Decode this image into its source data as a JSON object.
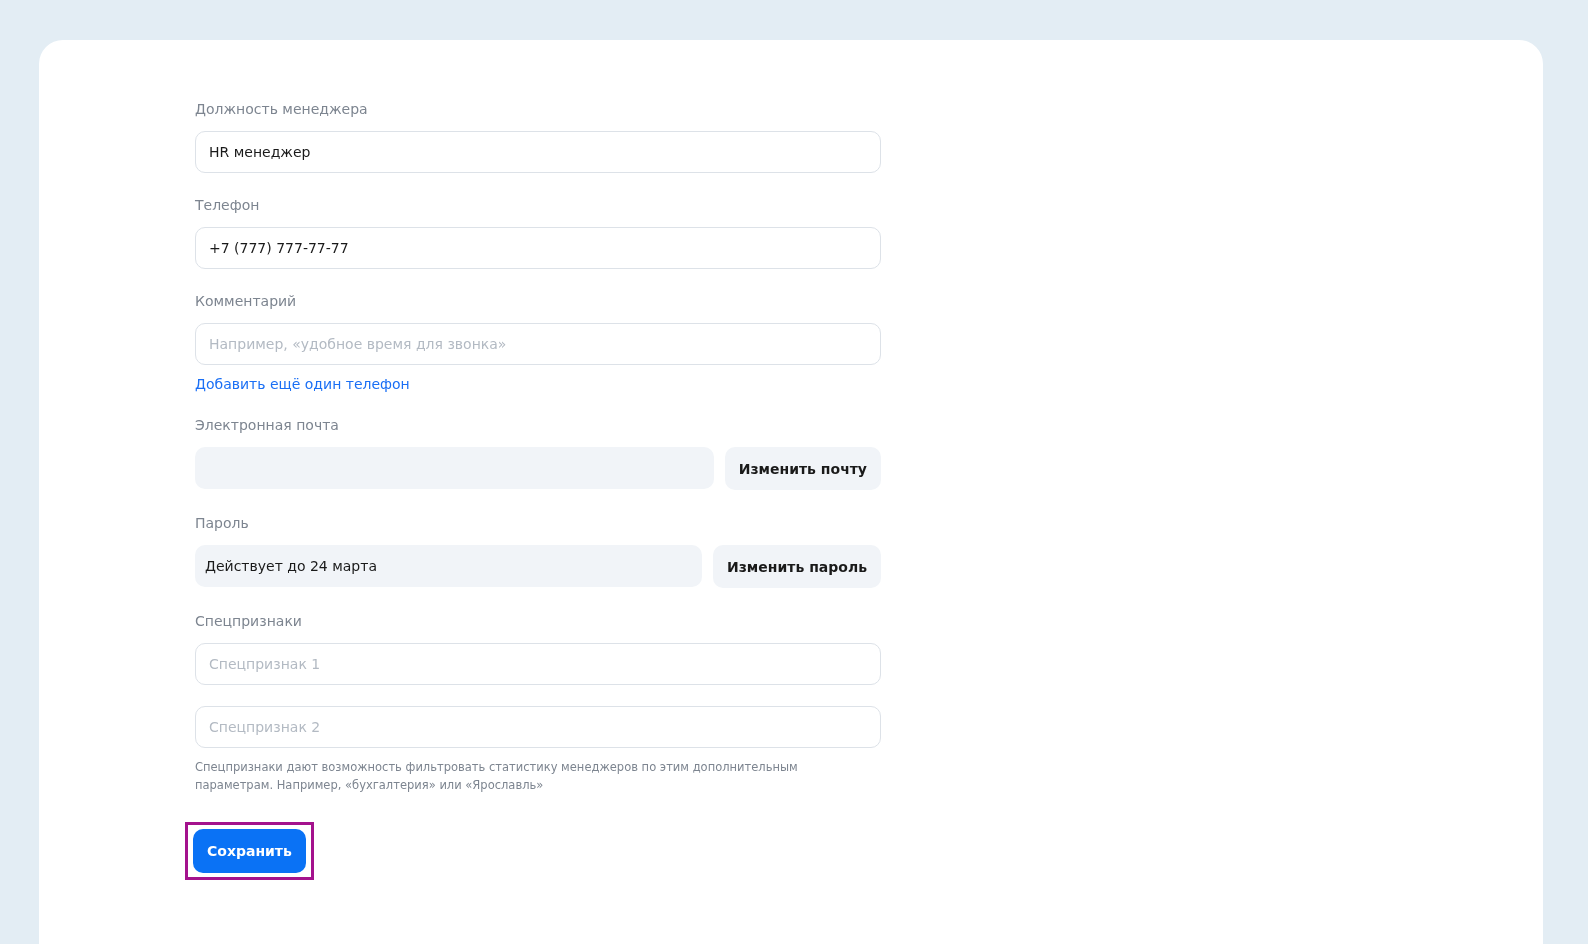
{
  "form": {
    "items": [
      {
        "kind": "label",
        "text": "Должность менеджера"
      },
      {
        "kind": "input",
        "value": "HR менеджер"
      },
      {
        "kind": "label",
        "text": "Телефон"
      },
      {
        "kind": "input",
        "value": "+7 (777) 777-77-77"
      },
      {
        "kind": "label",
        "text": "Комментарий"
      },
      {
        "kind": "input",
        "placeholder": "Например, «удобное время для звонка»"
      },
      {
        "kind": "link",
        "text": "Добавить ещё один телефон"
      },
      {
        "kind": "label",
        "text": "Электронная почта"
      },
      {
        "kind": "readonly",
        "button": "Изменить почту"
      },
      {
        "kind": "label",
        "text": "Пароль"
      },
      {
        "kind": "readonly",
        "value": "Действует до 24 марта",
        "button": "Изменить пароль"
      },
      {
        "kind": "label",
        "text": "Спецпризнаки"
      },
      {
        "kind": "input",
        "placeholder": "Спецпризнак 1"
      },
      {
        "kind": "input",
        "placeholder": "Спецпризнак 2"
      },
      {
        "kind": "hint",
        "text": "Спецпризнаки дают возможность фильтровать статистику менеджеров по этим дополнительным параметрам. Например, «бухгалтерия» или «Ярославль»"
      }
    ],
    "save_button": {
      "label": "Сохранить",
      "highlighted": true
    }
  }
}
